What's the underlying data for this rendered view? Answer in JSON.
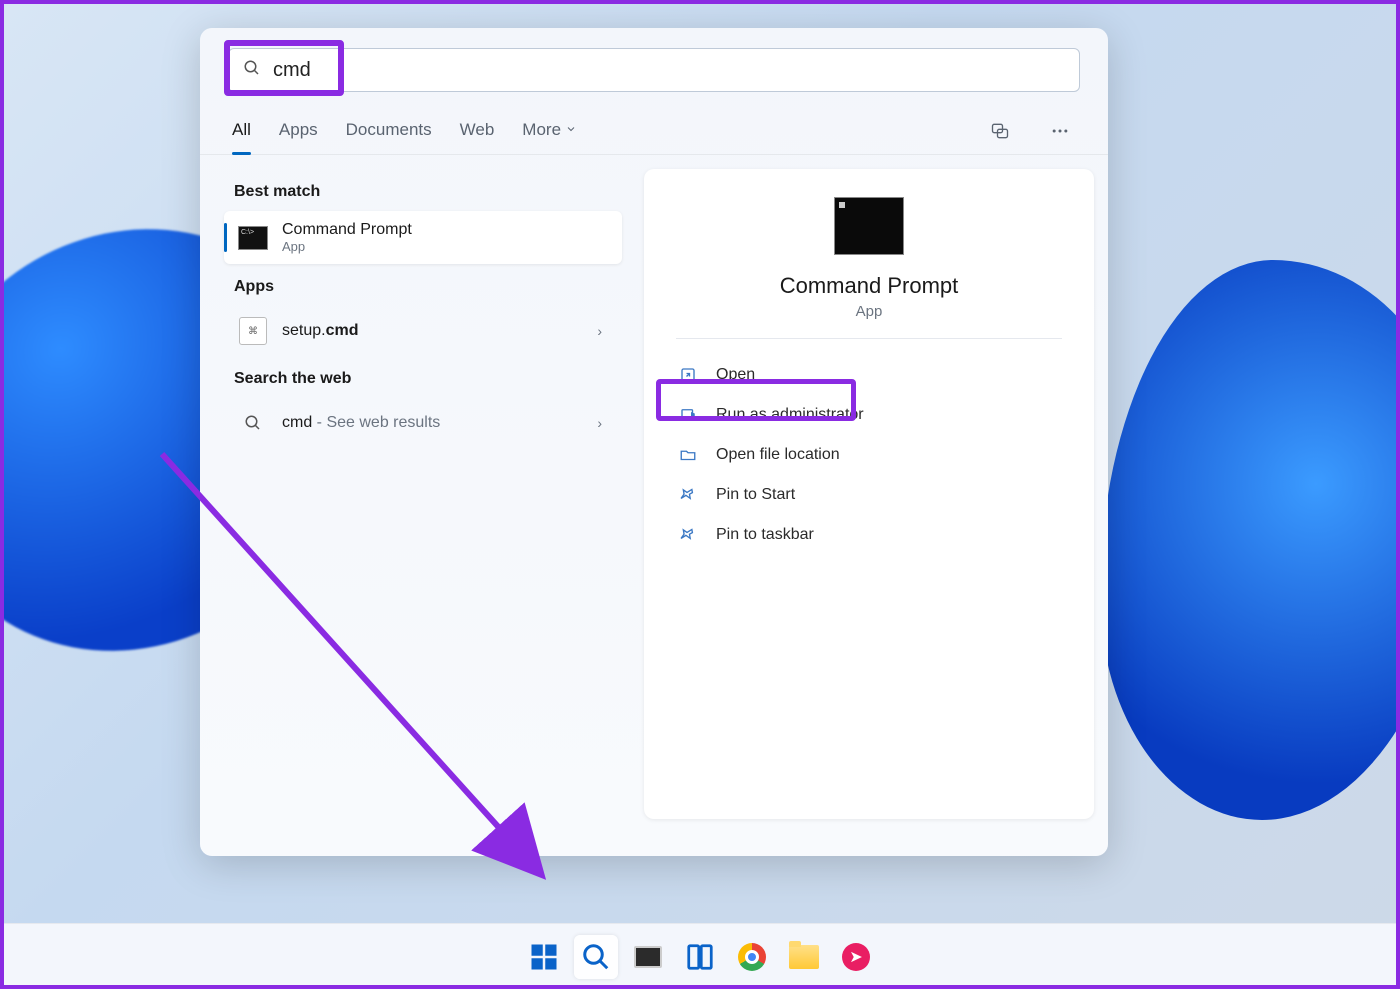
{
  "search": {
    "query": "cmd"
  },
  "tabs": {
    "all": "All",
    "apps": "Apps",
    "documents": "Documents",
    "web": "Web",
    "more": "More"
  },
  "sections": {
    "best_match": "Best match",
    "apps": "Apps",
    "search_web": "Search the web"
  },
  "results": {
    "best_match": {
      "title": "Command Prompt",
      "subtitle": "App"
    },
    "app_item": {
      "prefix": "setup.",
      "bold": "cmd"
    },
    "web_item": {
      "term": "cmd",
      "suffix": " - See web results"
    }
  },
  "preview": {
    "title": "Command Prompt",
    "subtitle": "App",
    "actions": {
      "open": "Open",
      "runadmin": "Run as administrator",
      "openloc": "Open file location",
      "pinstart": "Pin to Start",
      "pintask": "Pin to taskbar"
    }
  }
}
